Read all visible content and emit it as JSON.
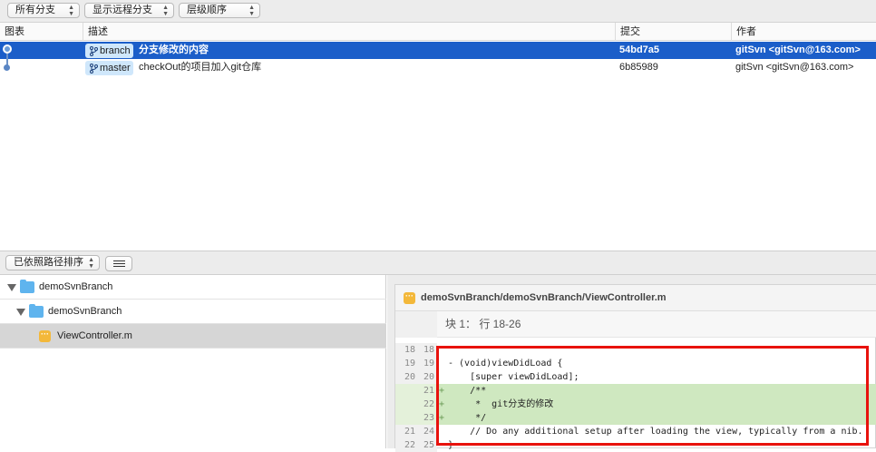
{
  "toolbar": {
    "branches_select": "所有分支",
    "remote_select": "显示远程分支",
    "order_select": "层级顺序"
  },
  "columns": {
    "graph": "图表",
    "description": "描述",
    "commit": "提交",
    "author": "作者"
  },
  "commits": [
    {
      "tag": "branch",
      "message": "分支修改的内容",
      "hash": "54bd7a5",
      "author": "gitSvn <gitSvn@163.com>",
      "selected": true
    },
    {
      "tag": "master",
      "message": "checkOut的项目加入git仓库",
      "hash": "6b85989",
      "author": "gitSvn <gitSvn@163.com>",
      "selected": false
    }
  ],
  "midbar": {
    "sort_select": "已依照路径排序"
  },
  "tree": {
    "items": [
      {
        "label": "demoSvnBranch",
        "kind": "folder"
      },
      {
        "label": "demoSvnBranch",
        "kind": "folder"
      },
      {
        "label": "ViewController.m",
        "kind": "file"
      }
    ]
  },
  "diff": {
    "file_icon": "···",
    "path": "demoSvnBranch/demoSvnBranch/ViewController.m",
    "hunk": "块 1：  行 18-26",
    "lines": [
      {
        "old": "18",
        "new": "18",
        "mark": "",
        "code": "",
        "type": "ctx"
      },
      {
        "old": "19",
        "new": "19",
        "mark": "",
        "code": "- (void)viewDidLoad {",
        "type": "ctx"
      },
      {
        "old": "20",
        "new": "20",
        "mark": "",
        "code": "    [super viewDidLoad];",
        "type": "ctx"
      },
      {
        "old": "",
        "new": "21",
        "mark": "+",
        "code": "    /**",
        "type": "add"
      },
      {
        "old": "",
        "new": "22",
        "mark": "+",
        "code": "     *  git分支的修改",
        "type": "add"
      },
      {
        "old": "",
        "new": "23",
        "mark": "+",
        "code": "     */",
        "type": "add"
      },
      {
        "old": "21",
        "new": "24",
        "mark": "",
        "code": "    // Do any additional setup after loading the view, typically from a nib.",
        "type": "ctx"
      },
      {
        "old": "22",
        "new": "25",
        "mark": "",
        "code": "}",
        "type": "ctx"
      }
    ]
  }
}
